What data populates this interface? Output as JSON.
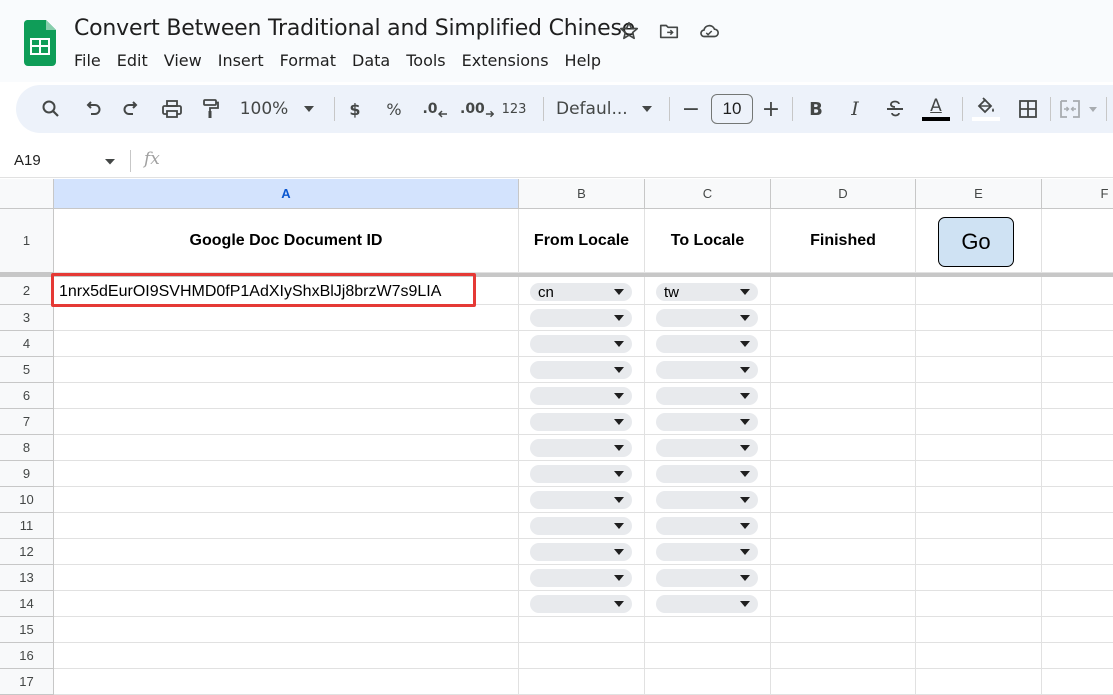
{
  "app": {
    "title": "Convert Between Traditional and Simplified Chinese",
    "menu": [
      "File",
      "Edit",
      "View",
      "Insert",
      "Format",
      "Data",
      "Tools",
      "Extensions",
      "Help"
    ]
  },
  "toolbar": {
    "zoom": "100%",
    "currency": "$",
    "percent": "%",
    "dec_decrease": ".0",
    "dec_increase": ".00",
    "number_format": "123",
    "font": "Defaul...",
    "minus": "−",
    "font_size": "10",
    "plus": "+",
    "bold": "B",
    "italic": "I",
    "text_color_letter": "A"
  },
  "formula_bar": {
    "name_box": "A19",
    "fx": "fx",
    "value": ""
  },
  "sheet": {
    "columns": [
      "A",
      "B",
      "C",
      "D",
      "E",
      "F"
    ],
    "rows": [
      "1",
      "2",
      "3",
      "4",
      "5",
      "6",
      "7",
      "8",
      "9",
      "10",
      "11",
      "12",
      "13",
      "14",
      "15",
      "16",
      "17"
    ],
    "headers": {
      "A": "Google Doc Document ID",
      "B": "From Locale",
      "C": "To Locale",
      "D": "Finished"
    },
    "go_button": "Go",
    "row2": {
      "A": "1nrx5dEurOI9SVHMD0fP1AdXIyShxBlJj8brzW7s9LIA",
      "B": "cn",
      "C": "tw"
    },
    "dropdown_rows_empty": [
      "3",
      "4",
      "5",
      "6",
      "7",
      "8",
      "9",
      "10",
      "11",
      "12",
      "13",
      "14"
    ]
  },
  "colors": {
    "accent_selected": "#d3e3fd",
    "go_button_bg": "#cfe2f3",
    "highlight_border": "#e53935",
    "sheets_green": "#0f9d58"
  }
}
